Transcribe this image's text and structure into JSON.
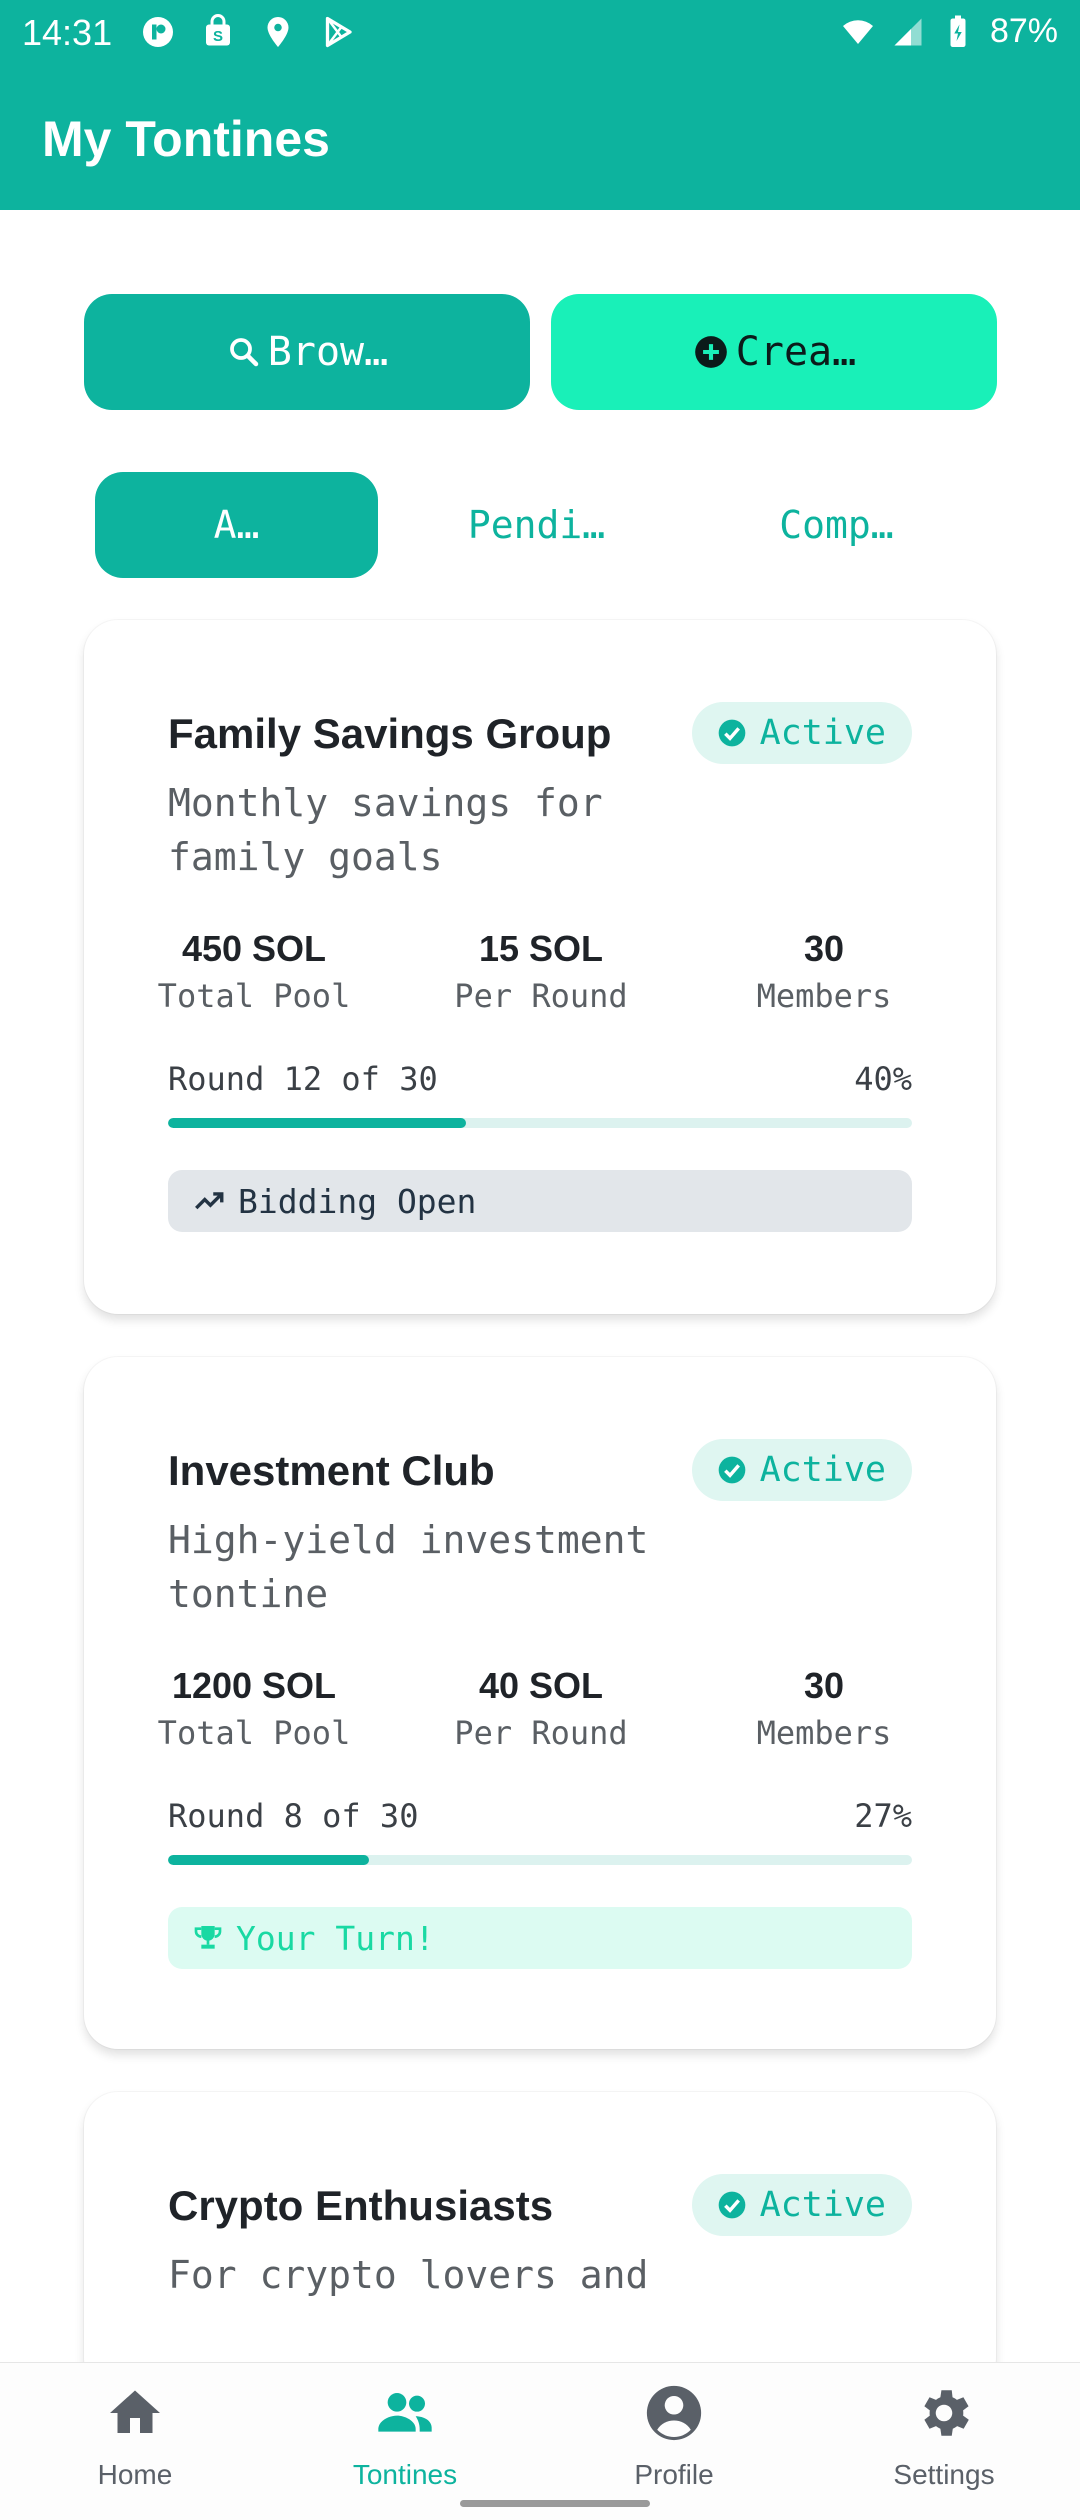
{
  "status_bar": {
    "time": "14:31",
    "battery": "87%",
    "left_icons": [
      "app-notification-icon",
      "shop-bag-icon",
      "location-icon",
      "play-store-icon"
    ],
    "right_icons": [
      "wifi-icon",
      "signal-icon",
      "battery-icon"
    ]
  },
  "app_bar": {
    "title": "My Tontines"
  },
  "actions": {
    "browse_label": "Brow…",
    "create_label": "Crea…"
  },
  "tabs": [
    {
      "label": "A…",
      "active": true
    },
    {
      "label": "Pendi…",
      "active": false
    },
    {
      "label": "Comp…",
      "active": false
    }
  ],
  "cards": [
    {
      "title": "Family Savings Group",
      "status": "Active",
      "description": "Monthly savings for family goals",
      "stats": [
        {
          "value": "450 SOL",
          "label": "Total Pool"
        },
        {
          "value": "15 SOL",
          "label": "Per Round"
        },
        {
          "value": "30",
          "label": "Members"
        }
      ],
      "round_text": "Round 12 of 30",
      "progress_label": "40%",
      "progress": 0.4,
      "pill": {
        "icon": "trending-up-icon",
        "text": "Bidding Open",
        "style": "grey"
      }
    },
    {
      "title": "Investment Club",
      "status": "Active",
      "description": "High-yield investment tontine",
      "stats": [
        {
          "value": "1200 SOL",
          "label": "Total Pool"
        },
        {
          "value": "40 SOL",
          "label": "Per Round"
        },
        {
          "value": "30",
          "label": "Members"
        }
      ],
      "round_text": "Round 8 of 30",
      "progress_label": "27%",
      "progress": 0.27,
      "pill": {
        "icon": "trophy-icon",
        "text": "Your Turn!",
        "style": "green"
      }
    },
    {
      "title": "Crypto Enthusiasts",
      "status": "Active",
      "description": "For crypto lovers and"
    }
  ],
  "bottom_nav": [
    {
      "label": "Home",
      "icon": "home-icon",
      "active": false
    },
    {
      "label": "Tontines",
      "icon": "group-icon",
      "active": true
    },
    {
      "label": "Profile",
      "icon": "profile-icon",
      "active": false
    },
    {
      "label": "Settings",
      "icon": "gear-icon",
      "active": false
    }
  ],
  "colors": {
    "primary": "#0db39e",
    "accent": "#19f0b8",
    "badge_bg": "#dff6f1",
    "grey_pill": "#e2e6ea",
    "green_pill": "#dcfbf2"
  }
}
